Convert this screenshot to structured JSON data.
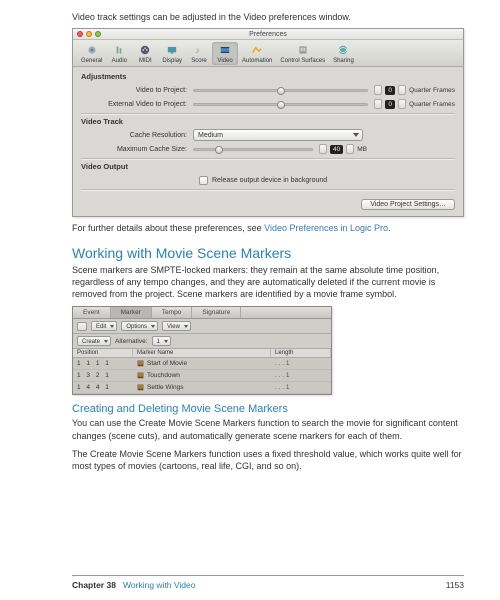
{
  "intro": "Video track settings can be adjusted in the Video preferences window.",
  "prefwin": {
    "title": "Preferences",
    "toolbar": [
      {
        "name": "general-icon",
        "label": "General"
      },
      {
        "name": "audio-icon",
        "label": "Audio"
      },
      {
        "name": "midi-icon",
        "label": "MIDI"
      },
      {
        "name": "display-icon",
        "label": "Display"
      },
      {
        "name": "score-icon",
        "label": "Score"
      },
      {
        "name": "video-icon",
        "label": "Video",
        "selected": true
      },
      {
        "name": "automation-icon",
        "label": "Automation"
      },
      {
        "name": "control-surfaces-icon",
        "label": "Control Surfaces"
      },
      {
        "name": "sharing-icon",
        "label": "Sharing"
      }
    ],
    "sections": {
      "adjustments_title": "Adjustments",
      "video_to_project_label": "Video to Project:",
      "video_to_project_value": "0",
      "external_video_to_project_label": "External Video to Project:",
      "external_video_to_project_value": "0",
      "unit": "Quarter Frames",
      "video_track_title": "Video Track",
      "cache_res_label": "Cache Resolution:",
      "cache_res_value": "Medium",
      "max_cache_label": "Maximum Cache Size:",
      "max_cache_value": "40",
      "max_cache_unit": "MB",
      "video_output_title": "Video Output",
      "release_cb_label": "Release output device in background",
      "btn_label": "Video Project Settings…"
    }
  },
  "caption_prefix": "For further details about these preferences, see ",
  "caption_link": "Video Preferences in Logic Pro",
  "caption_suffix": ".",
  "h2": "Working with Movie Scene Markers",
  "para1": "Scene markers are SMPTE-locked markers:  they remain at the same absolute time position, regardless of any tempo changes, and they are automatically deleted if the current movie is removed from the project. Scene markers are identified by a movie frame symbol.",
  "marker": {
    "tabs": [
      "Event",
      "Marker",
      "Tempo",
      "Signature"
    ],
    "selected_tab": "Marker",
    "bar_items": {
      "edit": "Edit",
      "options": "Options",
      "view": "View"
    },
    "bar2": {
      "create": "Create",
      "alt_label": "Alternative:",
      "alt_value": "1"
    },
    "headers": {
      "position": "Position",
      "name": "Marker Name",
      "length": "Length"
    },
    "rows": [
      {
        "pos": "1 1 1 1",
        "name": "Start of Movie",
        "len": ". . . 1"
      },
      {
        "pos": "1 3 2 1",
        "name": "Touchdown",
        "len": ". . . 1"
      },
      {
        "pos": "1 4 4 1",
        "name": "Settle Wings",
        "len": ". . . 1"
      }
    ]
  },
  "h3": "Creating and Deleting Movie Scene Markers",
  "para2": "You can use the Create Movie Scene Markers function to search the movie for significant content changes (scene cuts), and automatically generate scene markers for each of them.",
  "para3": "The Create Movie Scene Markers function uses a fixed threshold value, which works quite well for most types of movies (cartoons, real life, CGI, and so on).",
  "footer": {
    "chapter": "Chapter 38",
    "title": "Working with Video",
    "page": "1153"
  }
}
